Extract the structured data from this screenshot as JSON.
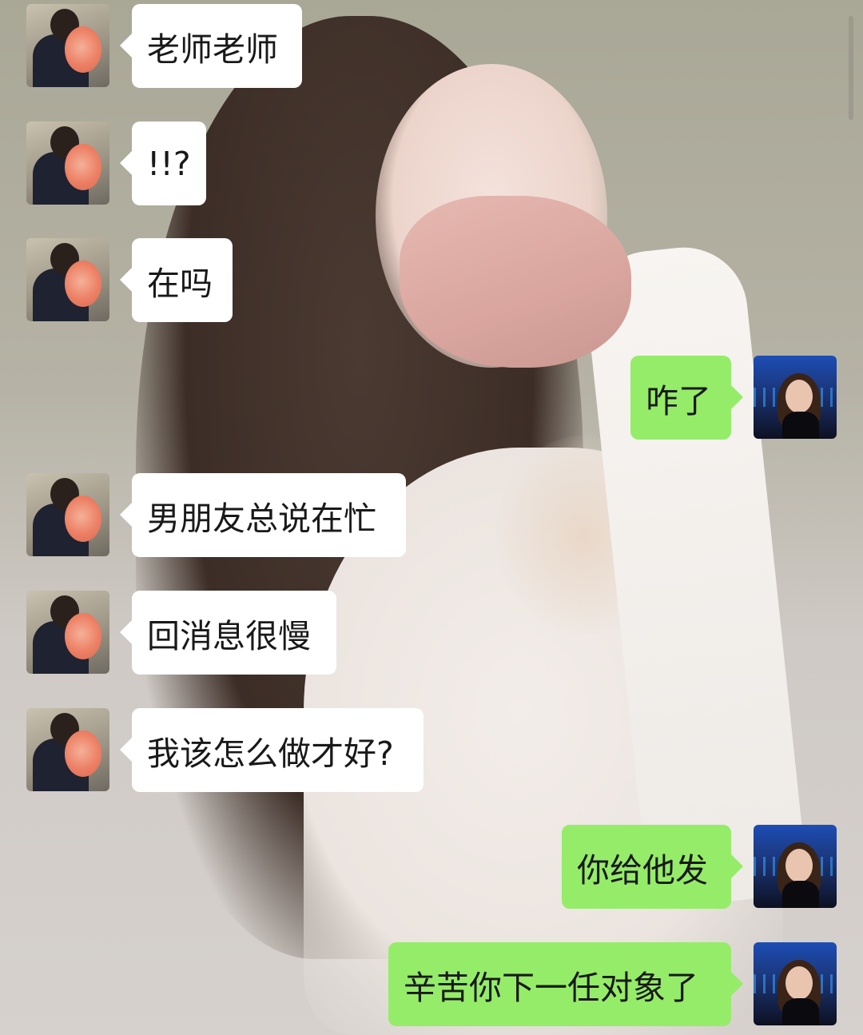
{
  "chat": {
    "messages": [
      {
        "sender": "contact",
        "text": "老师老师"
      },
      {
        "sender": "contact",
        "text": "!!?"
      },
      {
        "sender": "contact",
        "text": "在吗"
      },
      {
        "sender": "me",
        "text": "咋了"
      },
      {
        "sender": "contact",
        "text": "男朋友总说在忙"
      },
      {
        "sender": "contact",
        "text": "回消息很慢"
      },
      {
        "sender": "contact",
        "text": "我该怎么做才好?"
      },
      {
        "sender": "me",
        "text": "你给他发"
      },
      {
        "sender": "me",
        "text": "辛苦你下一任对象了"
      }
    ]
  },
  "colors": {
    "incoming_bubble": "#ffffff",
    "outgoing_bubble": "#95ec69",
    "text": "#191919"
  }
}
